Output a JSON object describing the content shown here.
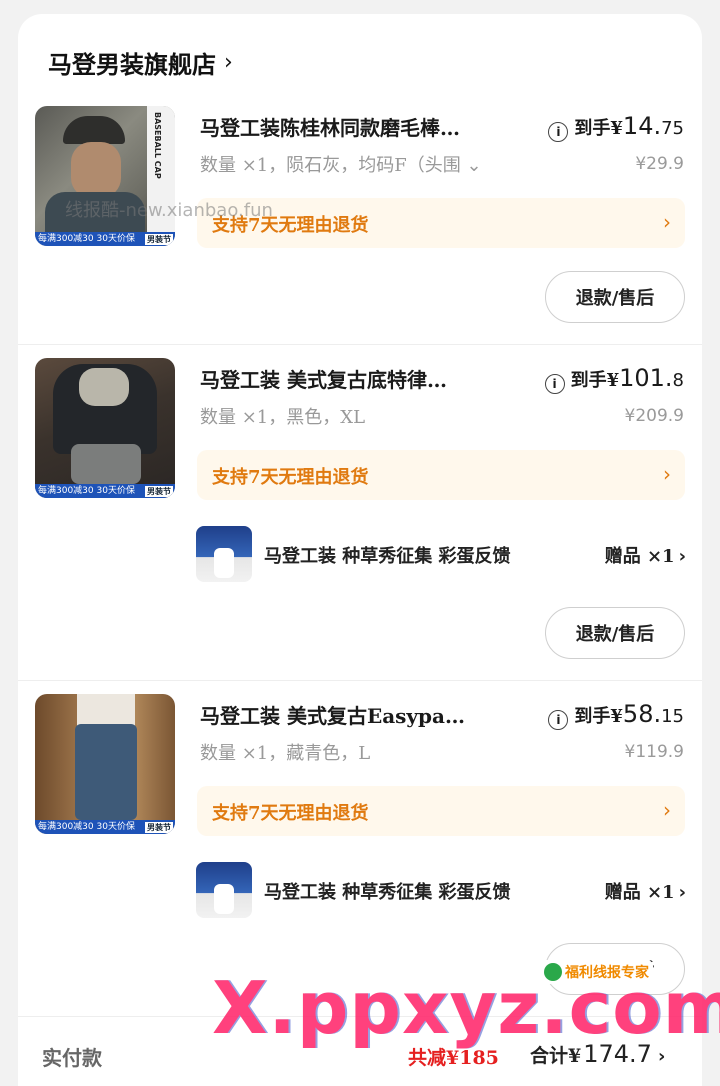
{
  "store": {
    "name": "马登男装旗舰店",
    "chevron": "›"
  },
  "products": [
    {
      "title": "马登工装陈桂林同款磨毛棒…",
      "price_label": "到手¥",
      "price_int": "14.",
      "price_dec": "75",
      "spec": "数量 ×1，陨石灰，均码F（头围 ⌄",
      "original_price": "¥29.9",
      "return_policy": "支持7天无理由退货",
      "refund_button": "退款/售后",
      "thumb_promo": "每满300减30 30天价保",
      "thumb_tag": "男装节",
      "thumb_text": "BASEBALL CAP"
    },
    {
      "title": "马登工装 美式复古底特律…",
      "price_label": "到手¥",
      "price_int": "101.",
      "price_dec": "8",
      "spec": "数量 ×1，黑色，XL",
      "original_price": "¥209.9",
      "return_policy": "支持7天无理由退货",
      "gift_name": "马登工装 种草秀征集 彩蛋反馈",
      "gift_qty": "赠品 ×1",
      "refund_button": "退款/售后",
      "thumb_promo": "每满300减30 30天价保",
      "thumb_tag": "男装节"
    },
    {
      "title": "马登工装 美式复古Easypa…",
      "price_label": "到手¥",
      "price_int": "58.",
      "price_dec": "15",
      "spec": "数量 ×1，藏青色，L",
      "original_price": "¥119.9",
      "return_policy": "支持7天无理由退货",
      "gift_name": "马登工装 种草秀征集 彩蛋反馈",
      "gift_qty": "赠品 ×1",
      "refund_button": "退款/售后",
      "thumb_promo": "每满300减30 30天价保",
      "thumb_tag": "男装节"
    }
  ],
  "footer": {
    "actual_pay": "实付款",
    "saved": "共减¥185",
    "total_label": "合计¥",
    "total_amount": "174.7"
  },
  "watermarks": {
    "top": "线报酷-new.xianbao.fun",
    "bottom": "X.ppxyz.com",
    "badge": "福利线报专家"
  },
  "colors": {
    "accent_orange": "#e07a10",
    "save_red": "#e52020",
    "promo_blue": "#1e53b8"
  }
}
